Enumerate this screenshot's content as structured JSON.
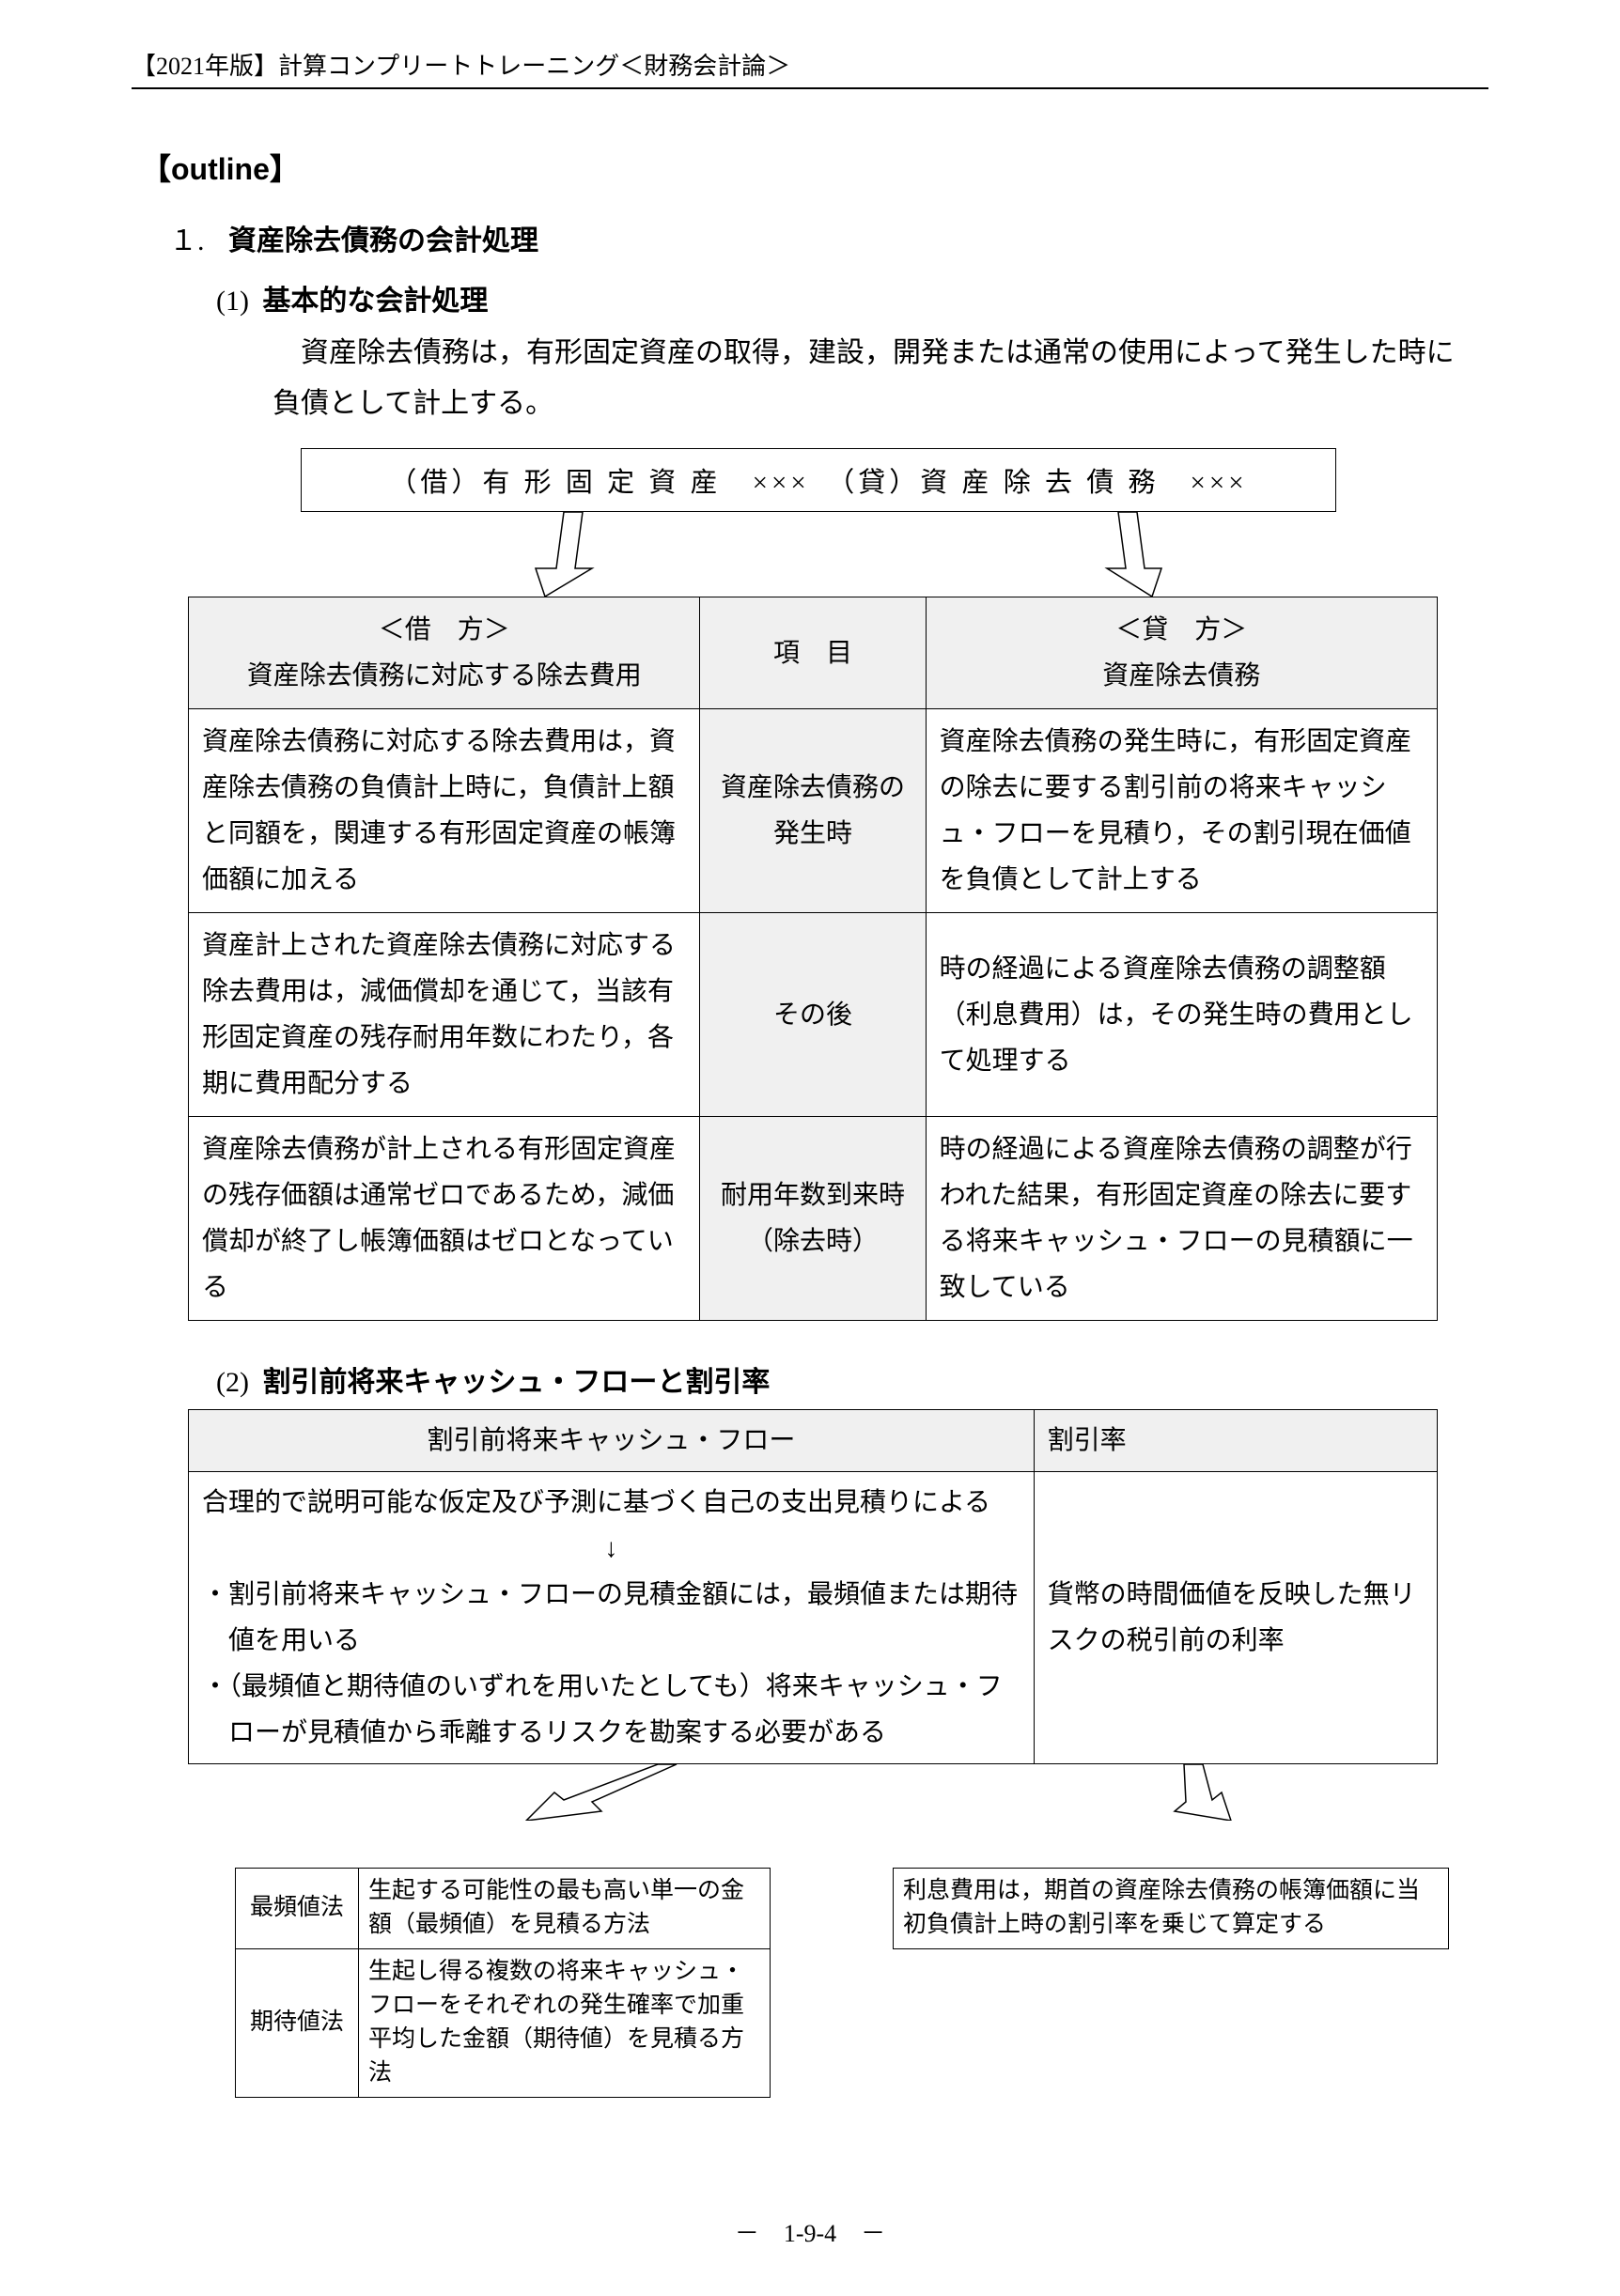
{
  "header": "【2021年版】計算コンプリートトレーニング＜財務会計論＞",
  "outline": "【outline】",
  "section1": {
    "num": "１.",
    "title": "資産除去債務の会計処理",
    "sub1": {
      "num": "(1)",
      "title": "基本的な会計処理",
      "para": "資産除去債務は，有形固定資産の取得，建設，開発または通常の使用によって発生した時に負債として計上する。"
    },
    "journal": "（借）有 形 固 定 資 産　×××　（貸）資 産 除 去 債 務　×××",
    "table": {
      "h_debit1": "＜借　方＞",
      "h_debit2": "資産除去債務に対応する除去費用",
      "h_item": "項　目",
      "h_credit1": "＜貸　方＞",
      "h_credit2": "資産除去債務",
      "rows": [
        {
          "debit": "資産除去債務に対応する除去費用は，資産除去債務の負債計上時に，負債計上額と同額を，関連する有形固定資産の帳簿価額に加える",
          "item": "資産除去債務の発生時",
          "credit": "資産除去債務の発生時に，有形固定資産の除去に要する割引前の将来キャッシュ・フローを見積り，その割引現在価値を負債として計上する"
        },
        {
          "debit": "資産計上された資産除去債務に対応する除去費用は，減価償却を通じて，当該有形固定資産の残存耐用年数にわたり，各期に費用配分する",
          "item": "その後",
          "credit": "時の経過による資産除去債務の調整額（利息費用）は，その発生時の費用として処理する"
        },
        {
          "debit": "資産除去債務が計上される有形固定資産の残存価額は通常ゼロであるため，減価償却が終了し帳簿価額はゼロとなっている",
          "item": "耐用年数到来時（除去時）",
          "credit": "時の経過による資産除去債務の調整が行われた結果，有形固定資産の除去に要する将来キャッシュ・フローの見積額に一致している"
        }
      ]
    },
    "sub2": {
      "num": "(2)",
      "title": "割引前将来キャッシュ・フローと割引率",
      "th_left": "割引前将来キャッシュ・フロー",
      "th_right": "割引率",
      "line1": "合理的で説明可能な仮定及び予測に基づく自己の支出見積りによる",
      "arrow": "↓",
      "line2": "・割引前将来キャッシュ・フローの見積金額には，最頻値または期待値を用いる",
      "line3": "・（最頻値と期待値のいずれを用いたとしても）将来キャッシュ・フローが見積値から乖離するリスクを勘案する必要がある",
      "right": "貨幣の時間価値を反映した無リスクの税引前の利率"
    },
    "methods": {
      "m1_label": "最頻値法",
      "m1_text": "生起する可能性の最も高い単一の金額（最頻値）を見積る方法",
      "m2_label": "期待値法",
      "m2_text": "生起し得る複数の将来キャッシュ・フローをそれぞれの発生確率で加重平均した金額（期待値）を見積る方法"
    },
    "interest_note": "利息費用は，期首の資産除去債務の帳簿価額に当初負債計上時の割引率を乗じて算定する"
  },
  "footer": "－　1-9-4　－"
}
